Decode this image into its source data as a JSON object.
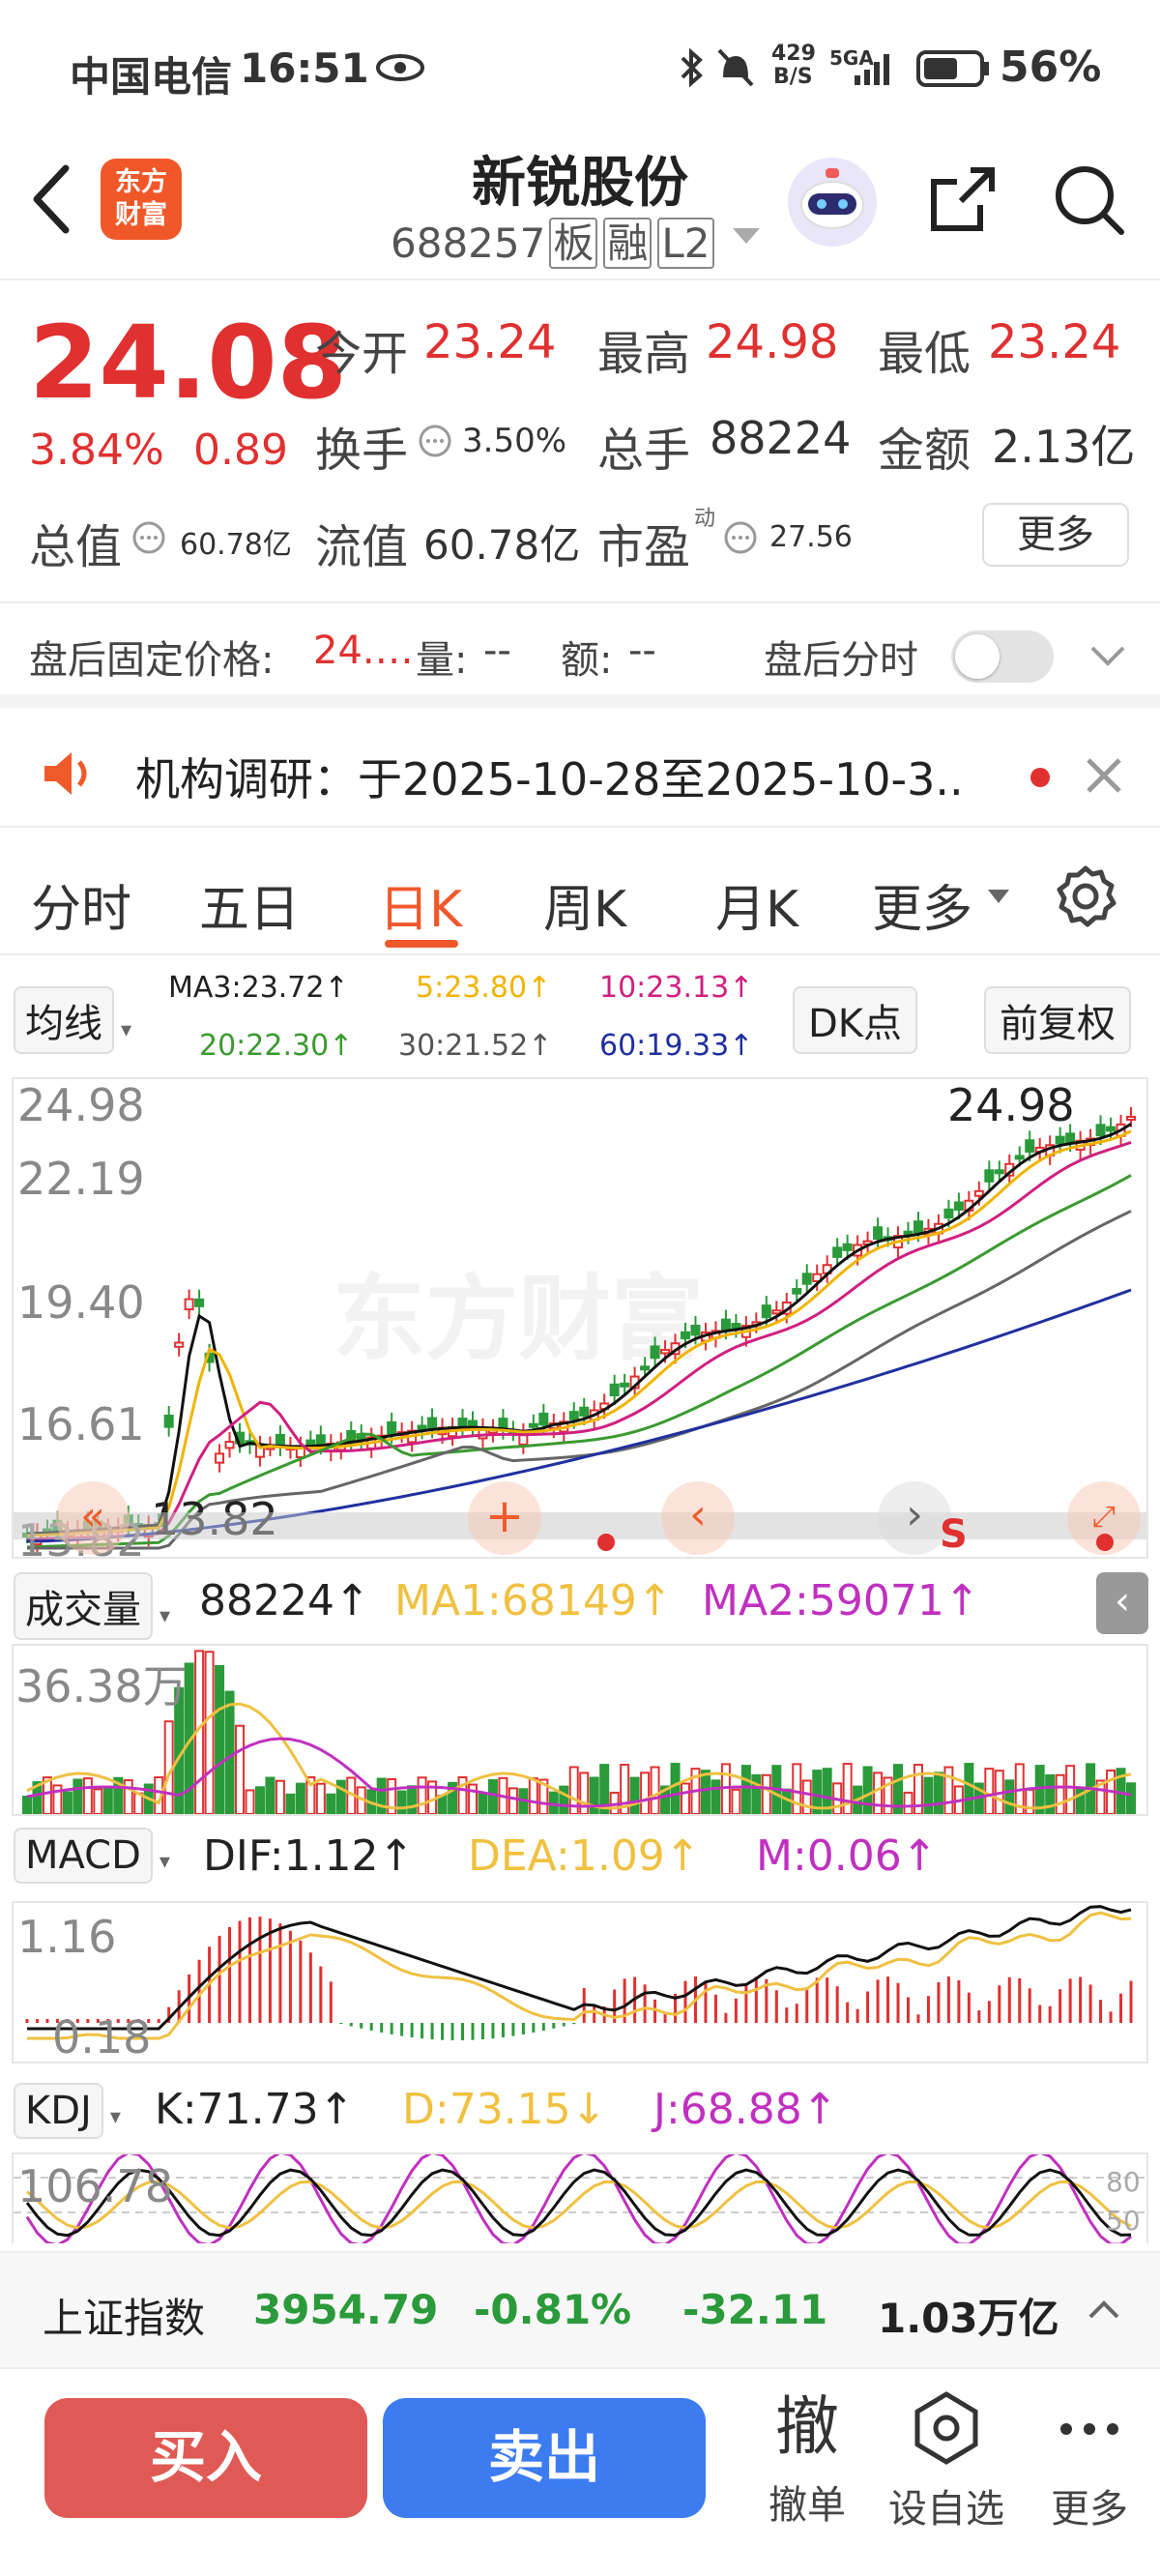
{
  "status_bar": {
    "carrier": "中国电信",
    "time": "16:51",
    "net_speed_top": "429",
    "net_speed_bottom": "B/S",
    "signal": "5GA",
    "battery": "56%"
  },
  "header": {
    "logo_text_1": "东方",
    "logo_text_2": "财富",
    "stock_name": "新锐股份",
    "stock_code": "688257",
    "tag_board": "板",
    "tag_margin": "融",
    "tag_level": "L2"
  },
  "quote": {
    "price": "24.08",
    "change_pct": "3.84%",
    "change": "0.89",
    "open_label": "今开",
    "open": "23.24",
    "high_label": "最高",
    "high": "24.98",
    "low_label": "最低",
    "low": "23.24",
    "turnover_label": "换手",
    "turnover": "3.50%",
    "volume_label": "总手",
    "volume": "88224",
    "amount_label": "金额",
    "amount": "2.13亿",
    "mktcap_label": "总值",
    "mktcap": "60.78亿",
    "float_label": "流值",
    "float_cap": "60.78亿",
    "pe_label": "市盈",
    "pe_sup": "动",
    "pe": "27.56",
    "more_button": "更多"
  },
  "after_hours": {
    "price_label": "盘后固定价格:",
    "price": "24.…",
    "vol_label": "量:",
    "vol": "--",
    "amt_label": "额:",
    "amt": "--",
    "timeshare_label": "盘后分时"
  },
  "notice": {
    "text": "机构调研：于2025-10-28至2025-10-3.."
  },
  "tabs": [
    "分时",
    "五日",
    "日K",
    "周K",
    "月K",
    "更多"
  ],
  "active_tab": 2,
  "ma_bar": {
    "select": "均线",
    "ma3": "MA3:23.72↑",
    "ma5": "5:23.80↑",
    "ma10": "10:23.13↑",
    "ma20": "20:22.30↑",
    "ma30": "30:21.52↑",
    "ma60": "60:19.33↑",
    "dk_button": "DK点",
    "adjust_button": "前复权"
  },
  "price_axis": [
    "24.98",
    "22.19",
    "19.40",
    "16.61",
    "13.82"
  ],
  "high_marker": "24.98",
  "low_marker": "13.82",
  "volume_bar": {
    "select": "成交量",
    "value": "88224↑",
    "ma1": "MA1:68149↑",
    "ma2": "MA2:59071↑",
    "axis": "36.38万"
  },
  "macd_bar": {
    "select": "MACD",
    "dif": "DIF:1.12↑",
    "dea": "DEA:1.09↑",
    "m": "M:0.06↑",
    "axis_top": "1.16",
    "axis_bottom": "0.18"
  },
  "kdj_bar": {
    "select": "KDJ",
    "k": "K:71.73↑",
    "d": "D:73.15↓",
    "j": "J:68.88↑",
    "axis_top": "106.78",
    "level_80": "80",
    "level_50": "50"
  },
  "index_bar": {
    "name": "上证指数",
    "value": "3954.79",
    "pct": "-0.81%",
    "change": "-32.11",
    "amount": "1.03万亿"
  },
  "bottom": {
    "buy": "买入",
    "sell": "卖出",
    "cancel_icon_text": "撤",
    "cancel": "撤单",
    "watch": "设自选",
    "more": "更多"
  },
  "colors": {
    "red": "#e03030",
    "green": "#2a9a3a",
    "buy": "#e05a55",
    "sell": "#3c7bf0",
    "ma5": "#f0b400",
    "ma10": "#d02080",
    "ma20": "#3a9a30",
    "ma30": "#666666",
    "ma60": "#2030a0"
  }
}
